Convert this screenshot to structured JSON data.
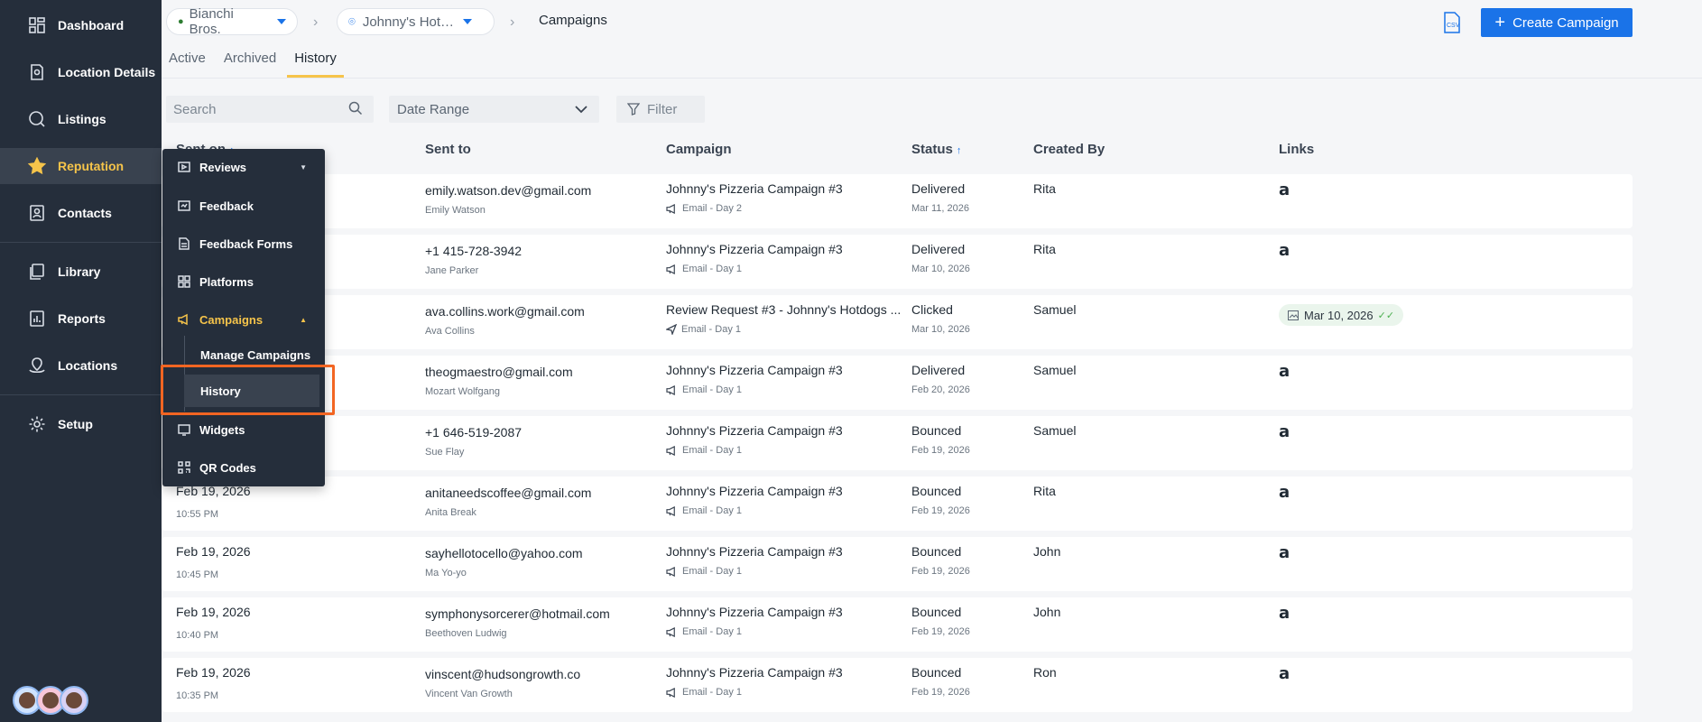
{
  "sidebar": {
    "items": [
      {
        "label": "Dashboard",
        "icon": "dashboard-icon"
      },
      {
        "label": "Location Details",
        "icon": "location-details-icon"
      },
      {
        "label": "Listings",
        "icon": "listings-icon"
      },
      {
        "label": "Reputation",
        "icon": "star-icon"
      },
      {
        "label": "Contacts",
        "icon": "contacts-icon"
      },
      {
        "label": "Library",
        "icon": "library-icon"
      },
      {
        "label": "Reports",
        "icon": "reports-icon"
      },
      {
        "label": "Locations",
        "icon": "locations-icon"
      },
      {
        "label": "Setup",
        "icon": "gear-icon"
      }
    ],
    "active": "Reputation"
  },
  "flyout": {
    "items": [
      {
        "label": "Reviews",
        "icon": "reviews-icon"
      },
      {
        "label": "Feedback",
        "icon": "feedback-icon"
      },
      {
        "label": "Feedback Forms",
        "icon": "feedback-forms-icon"
      },
      {
        "label": "Platforms",
        "icon": "platforms-icon"
      },
      {
        "label": "Campaigns",
        "icon": "megaphone-icon"
      },
      {
        "label": "Widgets",
        "icon": "widgets-icon"
      },
      {
        "label": "QR Codes",
        "icon": "qr-code-icon"
      }
    ],
    "sub_items": [
      {
        "label": "Manage Campaigns"
      },
      {
        "label": "History"
      }
    ]
  },
  "header": {
    "business": "Bianchi Bros.",
    "location": "Johnny's Hot…",
    "crumb": "Campaigns",
    "create_label": "Create Campaign"
  },
  "tabs": [
    {
      "label": "Active"
    },
    {
      "label": "Archived"
    },
    {
      "label": "History"
    }
  ],
  "filters": {
    "search_placeholder": "Search",
    "date_range_label": "Date Range",
    "filter_label": "Filter"
  },
  "table": {
    "columns": {
      "sent_on": "Sent on",
      "sent_to": "Sent to",
      "campaign": "Campaign",
      "status": "Status",
      "created_by": "Created By",
      "links": "Links"
    },
    "rows": [
      {
        "date": "",
        "time": "",
        "to": "emily.watson.dev@gmail.com",
        "name": "Emily Watson",
        "campaign": "Johnny's Pizzeria Campaign #3",
        "step": "Email - Day 2",
        "step_icon": "megaphone-icon",
        "status": "Delivered",
        "status_date": "Mar 11, 2026",
        "created_by": "Rita",
        "link": "a"
      },
      {
        "date": "",
        "time": "",
        "to": "+1 415-728-3942",
        "name": "Jane Parker",
        "campaign": "Johnny's Pizzeria Campaign #3",
        "step": "Email - Day 1",
        "step_icon": "megaphone-icon",
        "status": "Delivered",
        "status_date": "Mar 10, 2026",
        "created_by": "Rita",
        "link": "a"
      },
      {
        "date": "",
        "time": "",
        "to": "ava.collins.work@gmail.com",
        "name": "Ava Collins",
        "campaign": "Review Request #3 - Johnny's Hotdogs ...",
        "step": "Email - Day 1",
        "step_icon": "send-icon",
        "status": "Clicked",
        "status_date": "Mar 10, 2026",
        "created_by": "Samuel",
        "link_badge": "Mar 10, 2026"
      },
      {
        "date": "",
        "time": "",
        "to": "theogmaestro@gmail.com",
        "name": "Mozart Wolfgang",
        "campaign": "Johnny's Pizzeria Campaign #3",
        "step": "Email - Day 1",
        "step_icon": "megaphone-icon",
        "status": "Delivered",
        "status_date": "Feb 20, 2026",
        "created_by": "Samuel",
        "link": "a"
      },
      {
        "date": "",
        "time": "",
        "to": "+1 646-519-2087",
        "name": "Sue Flay",
        "campaign": "Johnny's Pizzeria Campaign #3",
        "step": "Email - Day 1",
        "step_icon": "megaphone-icon",
        "status": "Bounced",
        "status_date": "Feb 19, 2026",
        "created_by": "Samuel",
        "link": "a"
      },
      {
        "date": "Feb 19, 2026",
        "time": "10:55 PM",
        "to": "anitaneedscoffee@gmail.com",
        "name": "Anita Break",
        "campaign": "Johnny's Pizzeria Campaign #3",
        "step": "Email - Day 1",
        "step_icon": "megaphone-icon",
        "status": "Bounced",
        "status_date": "Feb 19, 2026",
        "created_by": "Rita",
        "link": "a"
      },
      {
        "date": "Feb 19, 2026",
        "time": "10:45 PM",
        "to": "sayhellotocello@yahoo.com",
        "name": "Ma Yo-yo",
        "campaign": "Johnny's Pizzeria Campaign #3",
        "step": "Email - Day 1",
        "step_icon": "megaphone-icon",
        "status": "Bounced",
        "status_date": "Feb 19, 2026",
        "created_by": "John",
        "link": "a"
      },
      {
        "date": "Feb 19, 2026",
        "time": "10:40 PM",
        "to": "symphonysorcerer@hotmail.com",
        "name": "Beethoven Ludwig",
        "campaign": "Johnny's Pizzeria Campaign #3",
        "step": "Email - Day 1",
        "step_icon": "megaphone-icon",
        "status": "Bounced",
        "status_date": "Feb 19, 2026",
        "created_by": "John",
        "link": "a"
      },
      {
        "date": "Feb 19, 2026",
        "time": "10:35 PM",
        "to": "vinscent@hudsongrowth.co",
        "name": "Vincent Van Growth",
        "campaign": "Johnny's Pizzeria Campaign #3",
        "step": "Email - Day 1",
        "step_icon": "megaphone-icon",
        "status": "Bounced",
        "status_date": "Feb 19, 2026",
        "created_by": "Ron",
        "link": "a"
      }
    ]
  },
  "colors": {
    "sidebar_bg": "#252e3b",
    "accent": "#1a73e8",
    "active_nav": "#f6c44a",
    "highlight": "#f26522"
  }
}
